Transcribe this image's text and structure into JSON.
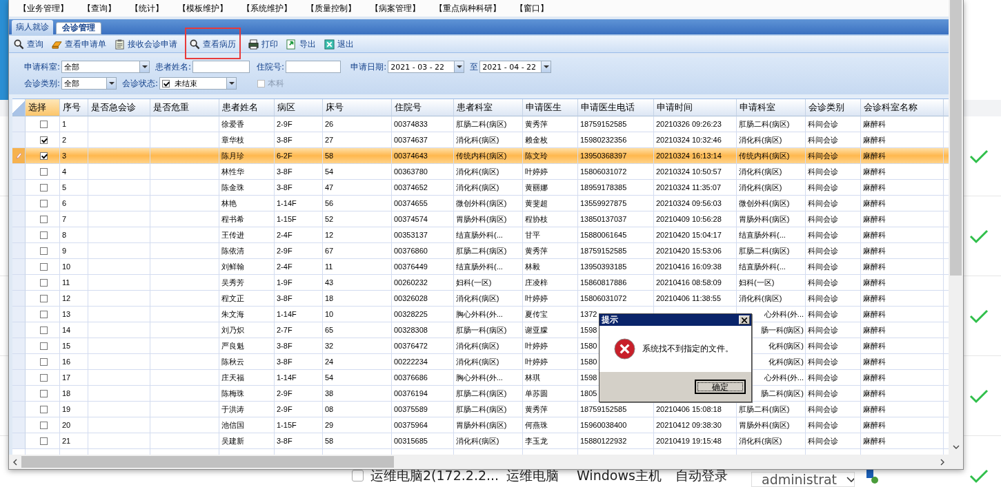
{
  "menu": [
    "【业务管理】",
    "【查询】",
    "【统计】",
    "【模板维护】",
    "【系统维护】",
    "【质量控制】",
    "【病案管理】",
    "【重点病种科研】",
    "【窗口】"
  ],
  "tabs": [
    {
      "label": "病人就诊",
      "selected": false
    },
    {
      "label": "会诊管理",
      "selected": true
    }
  ],
  "toolbar": [
    {
      "label": "查询",
      "kind": "search",
      "highlighted": false
    },
    {
      "label": "查看申请单",
      "kind": "form",
      "highlighted": false
    },
    {
      "label": "接收会诊申请",
      "kind": "clipboard",
      "highlighted": false
    },
    {
      "label": "查看病历",
      "kind": "search",
      "highlighted": true
    },
    {
      "label": "打印",
      "kind": "print",
      "highlighted": false
    },
    {
      "label": "导出",
      "kind": "export",
      "highlighted": false
    },
    {
      "label": "退出",
      "kind": "exit",
      "highlighted": false
    }
  ],
  "filters": {
    "dept_label": "申请科室:",
    "dept_value": "全部",
    "name_label": "患者姓名:",
    "inpatient_label": "住院号:",
    "date_label": "申请日期:",
    "date_from": "2021 - 03 - 22",
    "date_to_label": "至",
    "date_to": "2021 - 04 - 22",
    "type_label": "会诊类别:",
    "type_value": "全部",
    "status_label": "会诊状态:",
    "status_checked": true,
    "status_value": "未结束",
    "own_dept_label": "本科",
    "own_dept_checked": false,
    "own_dept_disabled": true
  },
  "table": {
    "columns": [
      "选择",
      "序号",
      "是否急会诊",
      "是否危重",
      "患者姓名",
      "病区",
      "床号",
      "住院号",
      "患者科室",
      "申请医生",
      "申请医生电话",
      "申请时间",
      "申请科室",
      "会诊类别",
      "会诊科室名称"
    ],
    "rows": [
      {
        "checked": false,
        "selected": false,
        "no": "1",
        "name": "徐爱香",
        "ward": "2-9F",
        "bed": "26",
        "inpatient_no": "00374833",
        "patient_dept": "肛肠二科(病区)",
        "doctor": "黄秀萍",
        "phone": "18759152585",
        "time": "20210326 09:26:23",
        "req_dept": "肛肠二科(病区)",
        "type": "科间会诊",
        "consult_dept": "麻醉科"
      },
      {
        "checked": true,
        "selected": false,
        "no": "2",
        "name": "章华枝",
        "ward": "3-8F",
        "bed": "27",
        "inpatient_no": "00374637",
        "patient_dept": "消化科(病区)",
        "doctor": "赖金枚",
        "phone": "15980232356",
        "time": "20210324 10:32:46",
        "req_dept": "消化科(病区)",
        "type": "科间会诊",
        "consult_dept": "麻醉科"
      },
      {
        "checked": true,
        "selected": true,
        "no": "3",
        "name": "陈月珍",
        "ward": "6-2F",
        "bed": "58",
        "inpatient_no": "00374643",
        "patient_dept": "传统内科(病区)",
        "doctor": "陈文玲",
        "phone": "13950368397",
        "time": "20210324 16:13:14",
        "req_dept": "传统内科(病区)",
        "type": "科间会诊",
        "consult_dept": "麻醉科"
      },
      {
        "checked": false,
        "selected": false,
        "no": "4",
        "name": "林性华",
        "ward": "3-8F",
        "bed": "54",
        "inpatient_no": "00363780",
        "patient_dept": "消化科(病区)",
        "doctor": "叶婷婷",
        "phone": "15806031072",
        "time": "20210324 10:50:57",
        "req_dept": "消化科(病区)",
        "type": "科间会诊",
        "consult_dept": "麻醉科"
      },
      {
        "checked": false,
        "selected": false,
        "no": "5",
        "name": "陈金珠",
        "ward": "3-8F",
        "bed": "47",
        "inpatient_no": "00374652",
        "patient_dept": "消化科(病区)",
        "doctor": "黄丽娜",
        "phone": "18959178385",
        "time": "20210324 11:35:07",
        "req_dept": "消化科(病区)",
        "type": "科间会诊",
        "consult_dept": "麻醉科"
      },
      {
        "checked": false,
        "selected": false,
        "no": "6",
        "name": "林艳",
        "ward": "1-14F",
        "bed": "56",
        "inpatient_no": "00374655",
        "patient_dept": "微创外科(病区)",
        "doctor": "黄斐超",
        "phone": "13559927875",
        "time": "20210324 09:56:03",
        "req_dept": "微创外科(病区)",
        "type": "科间会诊",
        "consult_dept": "麻醉科"
      },
      {
        "checked": false,
        "selected": false,
        "no": "7",
        "name": "程书希",
        "ward": "1-15F",
        "bed": "52",
        "inpatient_no": "00374574",
        "patient_dept": "胃肠外科(病区)",
        "doctor": "程协枝",
        "phone": "13850137037",
        "time": "20210409 10:56:28",
        "req_dept": "胃肠外科(病区)",
        "type": "科间会诊",
        "consult_dept": "麻醉科"
      },
      {
        "checked": false,
        "selected": false,
        "no": "8",
        "name": "王传进",
        "ward": "2-4F",
        "bed": "12",
        "inpatient_no": "00353137",
        "patient_dept": "结直肠外科(...",
        "doctor": "甘平",
        "phone": "15880061645",
        "time": "20210420 15:04:17",
        "req_dept": "结直肠外科(...",
        "type": "科间会诊",
        "consult_dept": "麻醉科"
      },
      {
        "checked": false,
        "selected": false,
        "no": "9",
        "name": "陈依清",
        "ward": "2-9F",
        "bed": "67",
        "inpatient_no": "00376860",
        "patient_dept": "肛肠二科(病区)",
        "doctor": "黄秀萍",
        "phone": "18759152585",
        "time": "20210420 15:53:06",
        "req_dept": "肛肠二科(病区)",
        "type": "科间会诊",
        "consult_dept": "麻醉科"
      },
      {
        "checked": false,
        "selected": false,
        "no": "10",
        "name": "刘鲜翰",
        "ward": "2-4F",
        "bed": "11",
        "inpatient_no": "00376449",
        "patient_dept": "结直肠外科(...",
        "doctor": "林毅",
        "phone": "13950393185",
        "time": "20210416 16:09:38",
        "req_dept": "结直肠外科(...",
        "type": "科间会诊",
        "consult_dept": "麻醉科"
      },
      {
        "checked": false,
        "selected": false,
        "no": "11",
        "name": "吴秀芳",
        "ward": "1-9F",
        "bed": "43",
        "inpatient_no": "00260232",
        "patient_dept": "妇科(一区)",
        "doctor": "庄凌梓",
        "phone": "15860817886",
        "time": "20210416 08:58:09",
        "req_dept": "妇科(一区)",
        "type": "科间会诊",
        "consult_dept": "麻醉科"
      },
      {
        "checked": false,
        "selected": false,
        "no": "12",
        "name": "程文正",
        "ward": "3-8F",
        "bed": "18",
        "inpatient_no": "00326028",
        "patient_dept": "消化科(病区)",
        "doctor": "叶婷婷",
        "phone": "15806031072",
        "time": "20210406 11:38:55",
        "req_dept": "消化科(病区)",
        "type": "科间会诊",
        "consult_dept": "麻醉科"
      },
      {
        "checked": false,
        "selected": false,
        "covered": true,
        "no": "13",
        "name": "朱文海",
        "ward": "1-14F",
        "bed": "10",
        "inpatient_no": "00328225",
        "patient_dept": "胸心外科(外...",
        "doctor": "夏传宝",
        "phone": "1372",
        "req_dept": "心外科(外...",
        "type": "科间会诊",
        "consult_dept": "麻醉科"
      },
      {
        "checked": false,
        "selected": false,
        "covered": true,
        "no": "14",
        "name": "刘乃炽",
        "ward": "2-7F",
        "bed": "65",
        "inpatient_no": "00328308",
        "patient_dept": "肛肠一科(病区)",
        "doctor": "谢亚朦",
        "phone": "1598",
        "req_dept": "肠一科(病区)",
        "type": "科间会诊",
        "consult_dept": "麻醉科"
      },
      {
        "checked": false,
        "selected": false,
        "covered": true,
        "no": "15",
        "name": "严良魁",
        "ward": "3-8F",
        "bed": "32",
        "inpatient_no": "00376472",
        "patient_dept": "消化科(病区)",
        "doctor": "叶婷婷",
        "phone": "1580",
        "req_dept": "化科(病区)",
        "type": "科间会诊",
        "consult_dept": "麻醉科"
      },
      {
        "checked": false,
        "selected": false,
        "covered": true,
        "no": "16",
        "name": "陈秋云",
        "ward": "3-8F",
        "bed": "24",
        "inpatient_no": "00222234",
        "patient_dept": "消化科(病区)",
        "doctor": "叶婷婷",
        "phone": "1580",
        "req_dept": "化科(病区)",
        "type": "科间会诊",
        "consult_dept": "麻醉科"
      },
      {
        "checked": false,
        "selected": false,
        "covered": true,
        "no": "17",
        "name": "庄天福",
        "ward": "1-14F",
        "bed": "54",
        "inpatient_no": "00376686",
        "patient_dept": "胸心外科(外...",
        "doctor": "林琪",
        "phone": "1598",
        "req_dept": "心外科(外...",
        "type": "科间会诊",
        "consult_dept": "麻醉科"
      },
      {
        "checked": false,
        "selected": false,
        "covered": true,
        "no": "18",
        "name": "陈梅珠",
        "ward": "2-9F",
        "bed": "38",
        "inpatient_no": "00376194",
        "patient_dept": "肛肠二科(病区)",
        "doctor": "单苏圆",
        "phone": "1805",
        "req_dept": "肠二科(病区)",
        "type": "科间会诊",
        "consult_dept": "麻醉科"
      },
      {
        "checked": false,
        "selected": false,
        "no": "19",
        "name": "于洪涛",
        "ward": "2-9F",
        "bed": "08",
        "inpatient_no": "00375589",
        "patient_dept": "肛肠二科(病区)",
        "doctor": "黄秀萍",
        "phone": "18759152585",
        "time": "20210406 15:08:18",
        "req_dept": "肛肠二科(病区)",
        "type": "科间会诊",
        "consult_dept": "麻醉科"
      },
      {
        "checked": false,
        "selected": false,
        "no": "20",
        "name": "池信国",
        "ward": "1-15F",
        "bed": "29",
        "inpatient_no": "00375964",
        "patient_dept": "胃肠外科(病区)",
        "doctor": "何燕珠",
        "phone": "15960038400",
        "time": "20210412 09:38:30",
        "req_dept": "胃肠外科(病区)",
        "type": "科间会诊",
        "consult_dept": "麻醉科"
      },
      {
        "checked": false,
        "selected": false,
        "no": "21",
        "name": "吴建新",
        "ward": "3-8F",
        "bed": "58",
        "inpatient_no": "00315685",
        "patient_dept": "消化科(病区)",
        "doctor": "李玉龙",
        "phone": "15880122932",
        "time": "20210419 19:15:48",
        "req_dept": "消化科(病区)",
        "type": "科间会诊",
        "consult_dept": "麻醉科"
      }
    ]
  },
  "dialog": {
    "title": "提示",
    "message": "系统找不到指定的文件。",
    "button": "确定"
  },
  "background_list": {
    "rows": [
      {
        "done": true
      },
      {
        "done": true
      },
      {
        "done": true
      },
      {
        "done": true
      },
      {
        "done": true,
        "checked": false,
        "name": "运维电脑2(172.2.2...",
        "type": "运维电脑",
        "host": "Windows主机",
        "login": "自动登录",
        "account": "administrat"
      }
    ]
  }
}
